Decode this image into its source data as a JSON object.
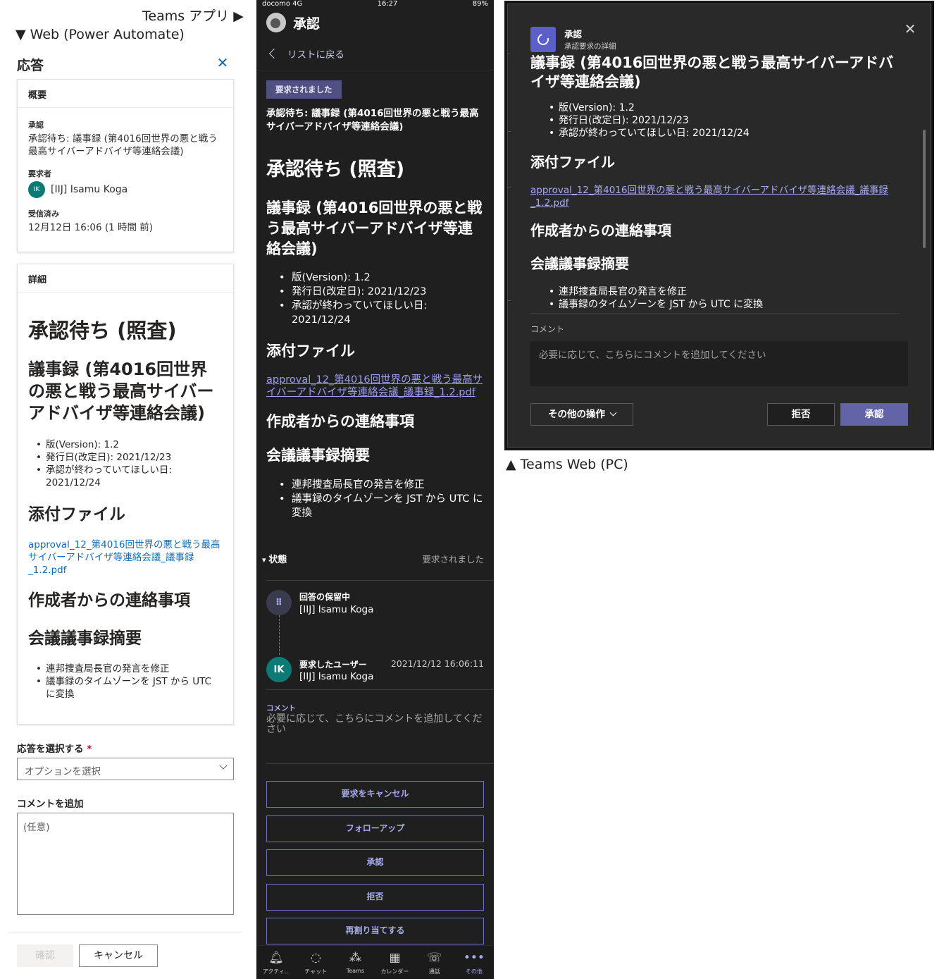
{
  "captions": {
    "teams_app": "Teams アプリ ▶",
    "web": "▼ Web (Power Automate)",
    "teams_pc": "▲ Teams Web (PC)"
  },
  "web": {
    "title": "応答",
    "close_icon": "close-icon",
    "summary": {
      "heading": "概要",
      "approval_label": "承認",
      "approval_value": "承認待ち: 議事録 (第4016回世界の悪と戦う最高サイバーアドバイザ等連絡会議)",
      "requester_label": "要求者",
      "requester_initials": "IK",
      "requester_name": "[IIJ] Isamu Koga",
      "received_label": "受信済み",
      "received_value": "12月12日 16:06 (1 時間 前)"
    },
    "details": {
      "heading": "詳細",
      "h1": "承認待ち (照査)",
      "h2": "議事録 (第4016回世界の悪と戦う最高サイバーアドバイザ等連絡会議)",
      "meta": [
        "版(Version): 1.2",
        "発行日(改定日): 2021/12/23",
        "承認が終わっていてほしい日: 2021/12/24"
      ],
      "attachments_heading": "添付ファイル",
      "attachment_link": "approval_12_第4016回世界の悪と戦う最高サイバーアドバイザ等連絡会議_議事録_1.2.pdf",
      "notes_heading": "作成者からの連絡事項",
      "summary_heading": "会議議事録摘要",
      "summary_items": [
        "連邦捜査局長官の発言を修正",
        "議事録のタイムゾーンを JST から UTC に変換"
      ]
    },
    "response_label": "応答を選択する",
    "required_mark": "*",
    "response_placeholder": "オプションを選択",
    "comment_label": "コメントを追加",
    "comment_placeholder": "(任意)",
    "confirm_button": "確認",
    "cancel_button": "キャンセル"
  },
  "mobile": {
    "status_left": "docomo 4G",
    "status_time": "16:27",
    "status_right": "89%",
    "app_title": "承認",
    "back_label": "リストに戻る",
    "badge": "要求されました",
    "subject": "承認待ち: 議事録 (第4016回世界の悪と戦う最高サイバーアドバイザ等連絡会議)",
    "h1": "承認待ち (照査)",
    "h2": "議事録 (第4016回世界の悪と戦う最高サイバーアドバイザ等連絡会議)",
    "meta": [
      "版(Version): 1.2",
      "発行日(改定日): 2021/12/23",
      "承認が終わっていてほしい日: 2021/12/24"
    ],
    "attachments_heading": "添付ファイル",
    "attachment_link": "approval_12_第4016回世界の悪と戦う最高サイバーアドバイザ等連絡会議_議事録_1.2.pdf",
    "notes_heading": "作成者からの連絡事項",
    "summary_heading": "会議議事録摘要",
    "summary_items": [
      "連邦捜査局長官の発言を修正",
      "議事録のタイムゾーンを JST から UTC に変換"
    ],
    "state_label": "状態",
    "state_value": "要求されました",
    "timeline": {
      "pending_title": "回答の保留中",
      "pending_name": "[IIJ] Isamu Koga",
      "requester_initials": "IK",
      "requester_title": "要求したユーザー",
      "requester_name": "[IIJ] Isamu Koga",
      "requester_date": "2021/12/12 16:06:11"
    },
    "comment_label": "コメント",
    "comment_placeholder": "必要に応じて、こちらにコメントを追加してください",
    "buttons": [
      "要求をキャンセル",
      "フォローアップ",
      "承認",
      "拒否",
      "再割り当てする"
    ],
    "nav": [
      {
        "label": "アクティ...",
        "icon": "bell-icon"
      },
      {
        "label": "チャット",
        "icon": "chat-icon"
      },
      {
        "label": "Teams",
        "icon": "teams-icon"
      },
      {
        "label": "カレンダー",
        "icon": "calendar-icon"
      },
      {
        "label": "通話",
        "icon": "phone-icon"
      },
      {
        "label": "その他",
        "icon": "more-icon"
      }
    ],
    "accent": "#a9acf0"
  },
  "pc": {
    "app_name": "承認",
    "subtitle": "承認要求の詳細",
    "h1": "議事録 (第4016回世界の悪と戦う最高サイバーアドバイザ等連絡会議)",
    "meta": [
      "版(Version): 1.2",
      "発行日(改定日): 2021/12/23",
      "承認が終わっていてほしい日: 2021/12/24"
    ],
    "attachments_heading": "添付ファイル",
    "attachment_link": "approval_12_第4016回世界の悪と戦う最高サイバーアドバイザ等連絡会議_議事録_1.2.pdf",
    "notes_heading": "作成者からの連絡事項",
    "summary_heading": "会議議事録摘要",
    "summary_items": [
      "連邦捜査局長官の発言を修正",
      "議事録のタイムゾーンを JST から UTC に変換"
    ],
    "comment_label": "コメント",
    "comment_placeholder": "必要に応じて、こちらにコメントを追加してください",
    "more_button": "その他の操作",
    "reject_button": "拒否",
    "approve_button": "承認",
    "accent": "#6264a7"
  }
}
